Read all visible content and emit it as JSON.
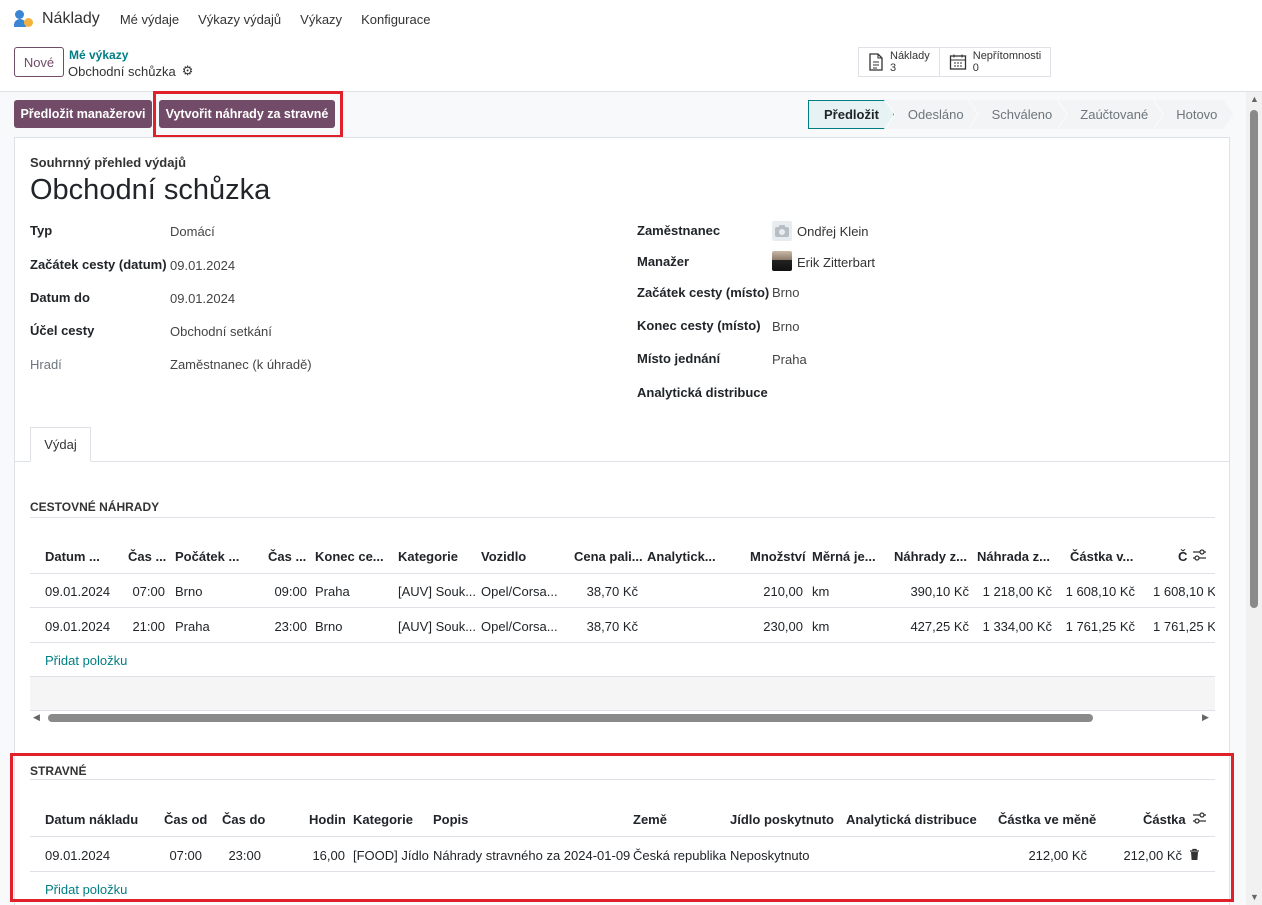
{
  "app": {
    "name": "Náklady"
  },
  "nav": [
    "Mé výdaje",
    "Výkazy výdajů",
    "Výkazy",
    "Konfigurace"
  ],
  "control_panel": {
    "new_button": "Nové",
    "breadcrumb": "Mé výkazy",
    "record_name": "Obchodní schůzka",
    "smart_buttons": [
      {
        "label": "Náklady",
        "value": "3",
        "icon": "document-icon"
      },
      {
        "label": "Nepřítomnosti",
        "value": "0",
        "icon": "calendar-icon"
      }
    ]
  },
  "actions": {
    "submit": "Předložit manažerovi",
    "create_meals": "Vytvořit náhrady za stravné"
  },
  "statusbar": [
    "Předložit",
    "Odesláno",
    "Schváleno",
    "Zaúčtované",
    "Hotovo"
  ],
  "form": {
    "subtitle": "Souhrnný přehled výdajů",
    "title": "Obchodní schůzka",
    "left_fields": [
      {
        "label": "Typ",
        "value": "Domácí"
      },
      {
        "label": "Začátek cesty (datum)",
        "value": "09.01.2024"
      },
      {
        "label": "Datum do",
        "value": "09.01.2024"
      },
      {
        "label": "Účel cesty",
        "value": "Obchodní setkání"
      },
      {
        "label": "Hradí",
        "value": "Zaměstnanec (k úhradě)"
      }
    ],
    "right_fields": [
      {
        "label": "Zaměstnanec",
        "value": "Ondřej Klein"
      },
      {
        "label": "Manažer",
        "value": "Erik Zitterbart"
      },
      {
        "label": "Začátek cesty (místo)",
        "value": "Brno"
      },
      {
        "label": "Konec cesty (místo)",
        "value": "Brno"
      },
      {
        "label": "Místo jednání",
        "value": "Praha"
      },
      {
        "label": "Analytická distribuce",
        "value": ""
      }
    ]
  },
  "tabs": [
    "Výdaj"
  ],
  "travel": {
    "title": "CESTOVNÉ NÁHRADY",
    "headers": [
      "Datum ...",
      "Čas ...",
      "Počátek ...",
      "Čas ...",
      "Konec ce...",
      "Kategorie",
      "Vozidlo",
      "Cena pali...",
      "Analytick...",
      "Množství",
      "Měrná je...",
      "Náhrady z...",
      "Náhrada z...",
      "Částka v...",
      "Č"
    ],
    "rows": [
      [
        "09.01.2024",
        "07:00",
        "Brno",
        "09:00",
        "Praha",
        "[AUV] Souk...",
        "Opel/Corsa...",
        "38,70 Kč",
        "",
        "210,00",
        "km",
        "390,10 Kč",
        "1 218,00 Kč",
        "1 608,10 Kč",
        "1 608,10 Kč"
      ],
      [
        "09.01.2024",
        "21:00",
        "Praha",
        "23:00",
        "Brno",
        "[AUV] Souk...",
        "Opel/Corsa...",
        "38,70 Kč",
        "",
        "230,00",
        "km",
        "427,25 Kč",
        "1 334,00 Kč",
        "1 761,25 Kč",
        "1 761,25 Kč"
      ]
    ],
    "add_line": "Přidat položku"
  },
  "meals": {
    "title": "STRAVNÉ",
    "headers": [
      "Datum nákladu",
      "Čas od",
      "Čas do",
      "Hodin",
      "Kategorie",
      "Popis",
      "Země",
      "Jídlo poskytnuto",
      "Analytická distribuce",
      "Částka ve měně",
      "Částka"
    ],
    "rows": [
      [
        "09.01.2024",
        "07:00",
        "23:00",
        "16,00",
        "[FOOD] Jídlo",
        "Náhrady stravného za 2024-01-09",
        "Česká republika",
        "Neposkytnuto",
        "",
        "212,00 Kč",
        "212,00 Kč"
      ]
    ],
    "add_line": "Přidat položku"
  }
}
